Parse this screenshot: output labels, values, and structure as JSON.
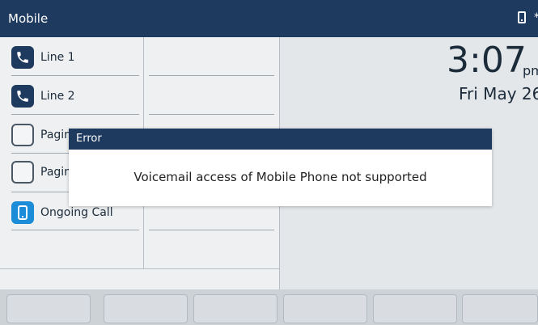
{
  "header": {
    "title": "Mobile",
    "status_icon": "mobile-phone-icon",
    "status_extra": "*"
  },
  "lines": [
    {
      "label": "Line 1",
      "icon": "phone-icon"
    },
    {
      "label": "Line 2",
      "icon": "phone-icon"
    },
    {
      "label": "Paging",
      "icon": "empty-line-key"
    },
    {
      "label": "Paging",
      "icon": "empty-line-key"
    },
    {
      "label": "Ongoing Call",
      "icon": "mobile-phone-icon"
    }
  ],
  "clock": {
    "time": "3:07",
    "ampm": "pm",
    "date": "Fri May 26"
  },
  "dialog": {
    "title": "Error",
    "message": "Voicemail access of Mobile Phone not supported"
  },
  "softkeys": [
    "",
    "",
    "",
    "",
    "",
    ""
  ],
  "colors": {
    "header": "#1e3a5f",
    "accent": "#1a8cd8"
  }
}
